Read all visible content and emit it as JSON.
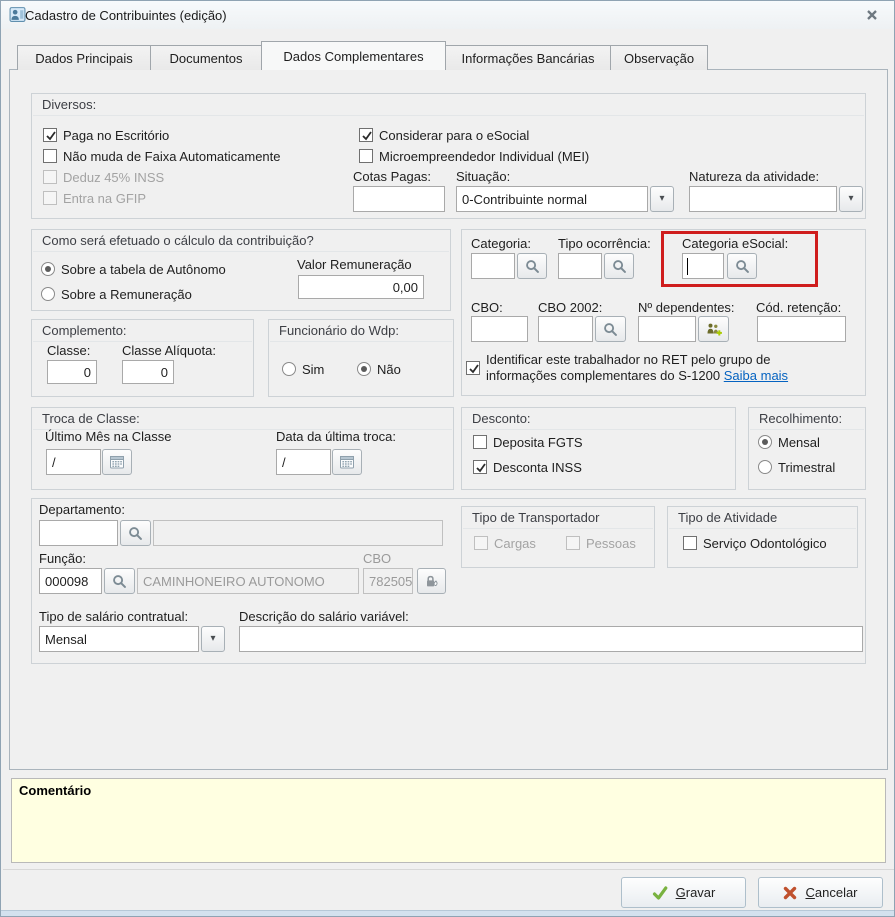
{
  "window": {
    "title": "Cadastro de Contribuintes (edição)"
  },
  "icons": {
    "dropdown_arrow": "▾"
  },
  "colors": {
    "highlight": "#cf1d1d",
    "link": "#0563c1",
    "comment_bg": "#ffffe1"
  },
  "tabs": [
    {
      "label": "Dados Principais",
      "active": false
    },
    {
      "label": "Documentos",
      "active": false
    },
    {
      "label": "Dados Complementares",
      "active": true
    },
    {
      "label": "Informações Bancárias",
      "active": false
    },
    {
      "label": "Observação",
      "active": false
    }
  ],
  "diversos": {
    "title": "Diversos:",
    "left_checks": [
      {
        "label": "Paga no Escritório",
        "checked": true,
        "disabled": false
      },
      {
        "label": "Não muda de Faixa Automaticamente",
        "checked": false,
        "disabled": false
      },
      {
        "label": "Deduz 45% INSS",
        "checked": false,
        "disabled": true
      },
      {
        "label": "Entra na GFIP",
        "checked": false,
        "disabled": true
      }
    ],
    "right_checks": [
      {
        "label": "Considerar para o eSocial",
        "checked": true,
        "disabled": false
      },
      {
        "label": "Microempreendedor Individual (MEI)",
        "checked": false,
        "disabled": false
      }
    ],
    "cotas_pagas": {
      "label": "Cotas Pagas:",
      "value": ""
    },
    "situacao": {
      "label": "Situação:",
      "value": "0-Contribuinte normal"
    },
    "natureza": {
      "label": "Natureza da atividade:",
      "value": ""
    }
  },
  "calculo": {
    "title": "Como será efetuado o cálculo da contribuição?",
    "radios": [
      {
        "label": "Sobre a tabela de Autônomo",
        "selected": true
      },
      {
        "label": "Sobre a Remuneração",
        "selected": false
      }
    ],
    "valor_remuneracao": {
      "label": "Valor Remuneração",
      "value": "0,00"
    }
  },
  "categoria_panel": {
    "categoria": {
      "label": "Categoria:",
      "value": ""
    },
    "tipo_ocorrencia": {
      "label": "Tipo ocorrência:",
      "value": ""
    },
    "categoria_esocial": {
      "label": "Categoria eSocial:",
      "value": ""
    },
    "cbo": {
      "label": "CBO:",
      "value": ""
    },
    "cbo_2002": {
      "label": "CBO 2002:",
      "value": ""
    },
    "num_dependentes": {
      "label": "Nº dependentes:",
      "value": ""
    },
    "cod_retencao": {
      "label": "Cód. retenção:",
      "value": ""
    },
    "ret": {
      "checked": true,
      "label": "Identificar este trabalhador no RET pelo grupo de informações complementares do S-1200",
      "link": "Saiba mais"
    }
  },
  "complemento": {
    "title": "Complemento:",
    "classe": {
      "label": "Classe:",
      "value": "0"
    },
    "classe_aliquota": {
      "label": "Classe Alíquota:",
      "value": "0"
    }
  },
  "wdp": {
    "title": "Funcionário do Wdp:",
    "radios": [
      {
        "label": "Sim",
        "selected": false
      },
      {
        "label": "Não",
        "selected": true
      }
    ]
  },
  "troca": {
    "title": "Troca de Classe:",
    "ultimo_mes": {
      "label": "Último Mês na Classe",
      "value": "/"
    },
    "data_ultima": {
      "label": "Data da última troca:",
      "value": "/"
    }
  },
  "desconto": {
    "title": "Desconto:",
    "checks": [
      {
        "label": "Deposita FGTS",
        "checked": false
      },
      {
        "label": "Desconta INSS",
        "checked": true
      }
    ]
  },
  "recolhimento": {
    "title": "Recolhimento:",
    "radios": [
      {
        "label": "Mensal",
        "selected": true
      },
      {
        "label": "Trimestral",
        "selected": false
      }
    ]
  },
  "vinculo": {
    "departamento": {
      "label": "Departamento:",
      "code": "",
      "name": ""
    },
    "funcao": {
      "label": "Função:",
      "code": "000098",
      "name": "CAMINHONEIRO AUTONOMO"
    },
    "cbo": {
      "label": "CBO",
      "value": "782505"
    },
    "transportador": {
      "title": "Tipo de Transportador",
      "checks": [
        {
          "label": "Cargas",
          "checked": false,
          "disabled": true
        },
        {
          "label": "Pessoas",
          "checked": false,
          "disabled": true
        }
      ]
    },
    "atividade": {
      "title": "Tipo de Atividade",
      "checks": [
        {
          "label": "Serviço Odontológico",
          "checked": false,
          "disabled": false
        }
      ]
    },
    "tipo_salario": {
      "label": "Tipo de salário contratual:",
      "value": "Mensal"
    },
    "desc_salario": {
      "label": "Descrição do salário variável:",
      "value": ""
    }
  },
  "comentario": {
    "label": "Comentário",
    "value": ""
  },
  "footer": {
    "gravar": "Gravar",
    "cancelar": "Cancelar"
  }
}
